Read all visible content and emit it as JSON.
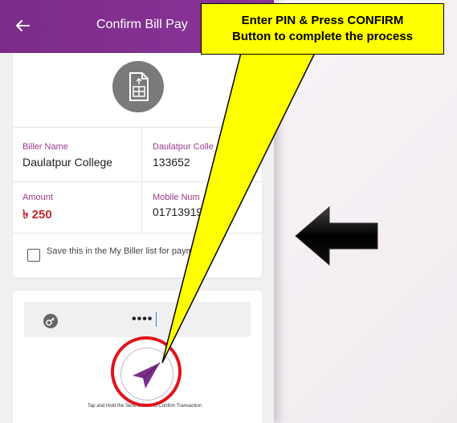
{
  "appbar": {
    "title": "Confirm Bill Pay",
    "back_icon": "back-arrow-icon"
  },
  "bill_card": {
    "icon": "bill-document-icon",
    "fields": [
      {
        "label": "Biller Name",
        "value": "Daulatpur College"
      },
      {
        "label": "Daulatpur Colle",
        "value": "133652"
      },
      {
        "label": "Amount",
        "value": "৳ 250"
      },
      {
        "label": "Mobile Num",
        "value": "01713919"
      }
    ],
    "save_checkbox": {
      "checked": false,
      "text": "Save this in the My Biller list for payments."
    }
  },
  "pin": {
    "icon": "key-icon",
    "value": "••••"
  },
  "confirm": {
    "icon": "send-arrow-icon",
    "hint": "Tap and Hold the Send Button to Confirm Transaction"
  },
  "annotation": {
    "callout_line1": "Enter PIN & Press CONFIRM",
    "callout_line2": "Button to complete the process",
    "callout_color": "#ffff00",
    "highlight_color": "#e0141b",
    "arrow_icon": "left-arrow-icon"
  },
  "colors": {
    "brand": "#7b2c8a",
    "amount": "#c1272d"
  }
}
